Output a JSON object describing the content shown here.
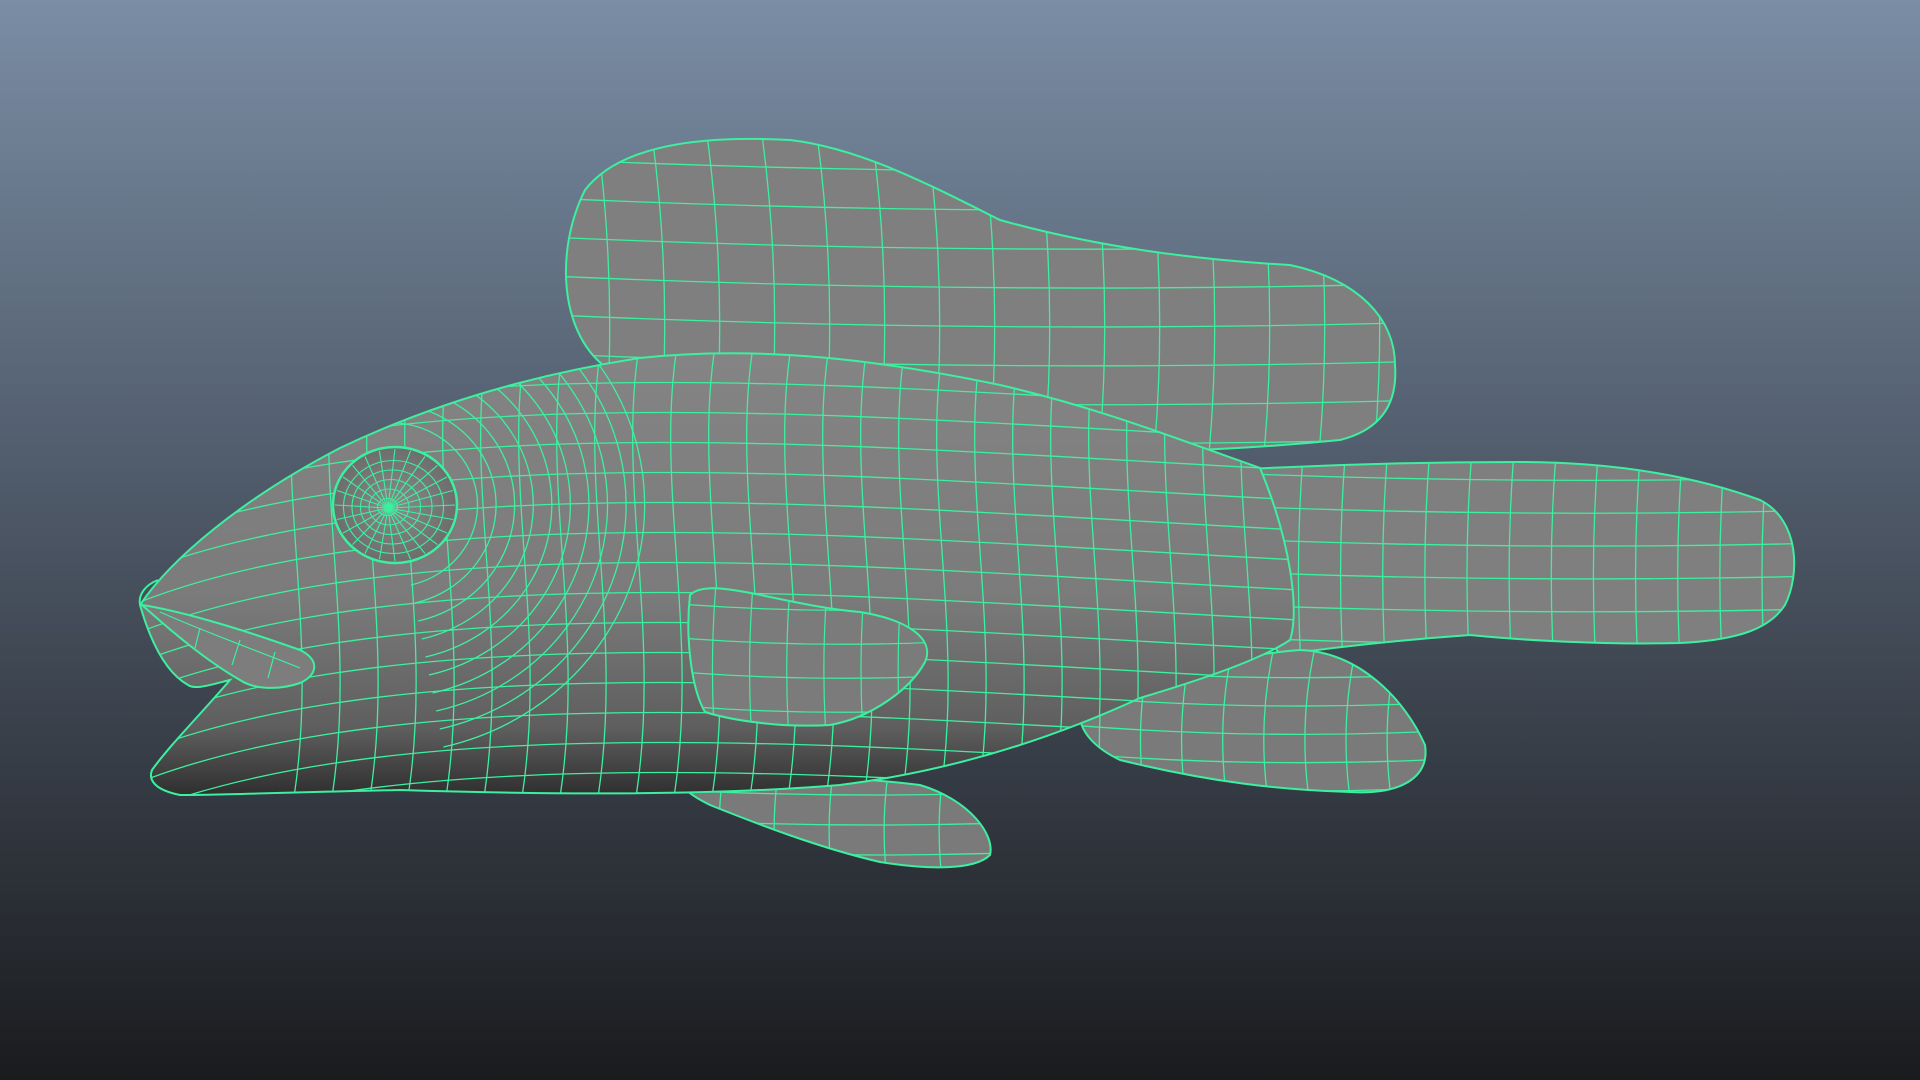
{
  "viewport": {
    "background_top": "#7a8da4",
    "background_bottom": "#1a1b1e",
    "mesh_fill": "#7d7d7d",
    "wireframe_color": "#3cf0a0",
    "selection_state": "object-selected"
  },
  "model": {
    "icon": "fish-mesh-icon",
    "parts": [
      "body",
      "dorsal-fin",
      "tail-fin",
      "anal-fin",
      "pelvic-fin",
      "pectoral-fin",
      "eye",
      "upper-lip"
    ]
  }
}
